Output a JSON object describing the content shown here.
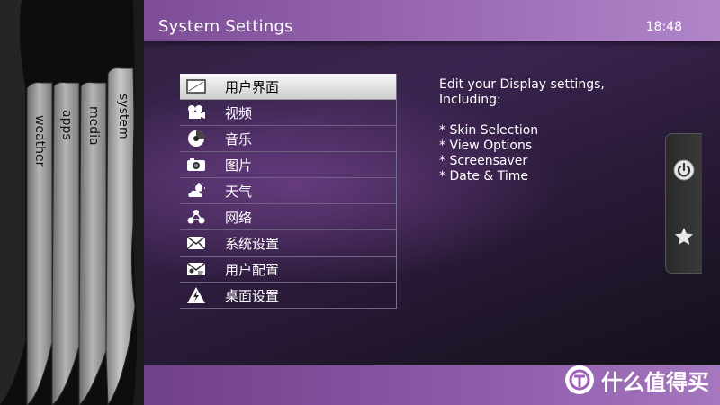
{
  "header": {
    "title": "System Settings",
    "clock": "18:48"
  },
  "tabs": [
    {
      "label": "weather"
    },
    {
      "label": "apps"
    },
    {
      "label": "media"
    },
    {
      "label": "system"
    }
  ],
  "menu": {
    "items": [
      {
        "label": "用户界面",
        "icon": "display-icon",
        "selected": true
      },
      {
        "label": "视频",
        "icon": "video-camera-icon"
      },
      {
        "label": "音乐",
        "icon": "music-disc-icon"
      },
      {
        "label": "图片",
        "icon": "camera-icon"
      },
      {
        "label": "天气",
        "icon": "weather-icon"
      },
      {
        "label": "网络",
        "icon": "network-icon"
      },
      {
        "label": "系统设置",
        "icon": "system-settings-icon"
      },
      {
        "label": "用户配置",
        "icon": "user-profile-icon"
      },
      {
        "label": "桌面设置",
        "icon": "warning-icon"
      }
    ]
  },
  "description": {
    "line1": "Edit your Display settings,",
    "line2": "Including:",
    "bullets": [
      "* Skin Selection",
      "* View Options",
      "* Screensaver",
      "* Date & Time"
    ]
  },
  "side_buttons": {
    "power": "power-icon",
    "favourites": "star-icon"
  },
  "watermark": {
    "text": "什么值得买"
  },
  "colors": {
    "topbar": "#9a6ab5",
    "bottombar": "#8f5aaa",
    "selected_bg": "#e6e6e6",
    "tab_fill": "#9c9c9c"
  }
}
